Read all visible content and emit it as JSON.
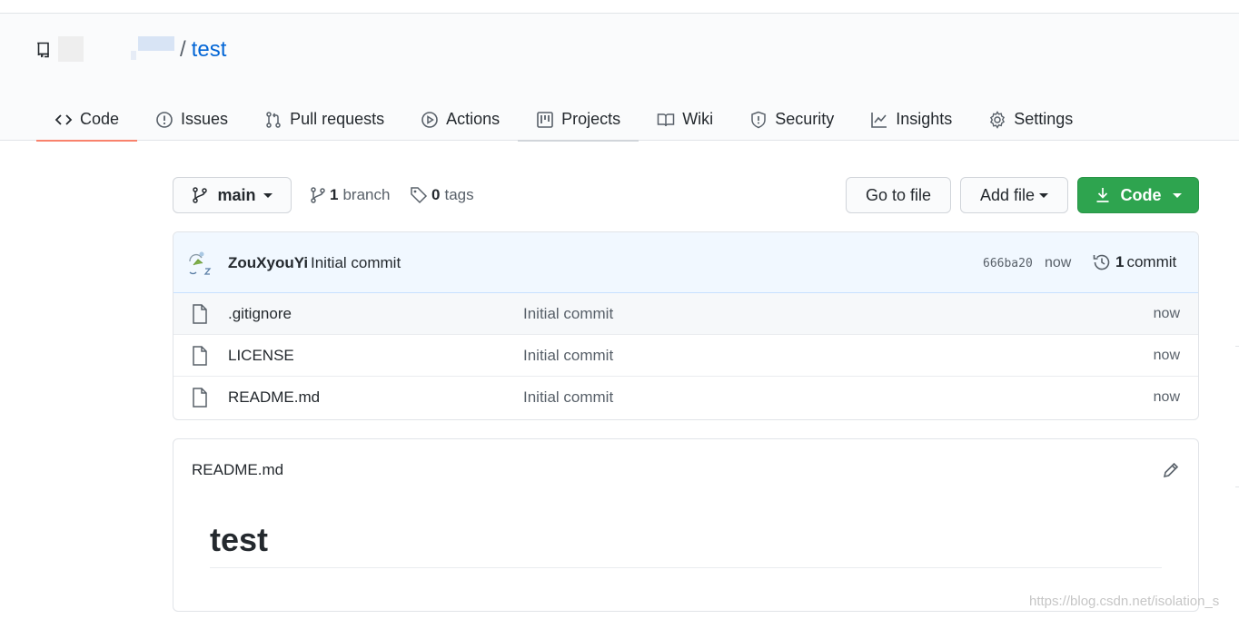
{
  "repo": {
    "name": "test",
    "separator": "/"
  },
  "tabs": [
    {
      "label": "Code",
      "icon": "code-icon"
    },
    {
      "label": "Issues",
      "icon": "issue-icon"
    },
    {
      "label": "Pull requests",
      "icon": "pull-request-icon"
    },
    {
      "label": "Actions",
      "icon": "play-icon"
    },
    {
      "label": "Projects",
      "icon": "project-icon"
    },
    {
      "label": "Wiki",
      "icon": "book-icon"
    },
    {
      "label": "Security",
      "icon": "shield-icon"
    },
    {
      "label": "Insights",
      "icon": "graph-icon"
    },
    {
      "label": "Settings",
      "icon": "gear-icon"
    }
  ],
  "toolbar": {
    "branch_selector": "main",
    "branch_count": "1",
    "branch_label": "branch",
    "tag_count": "0",
    "tag_label": "tags",
    "go_to_file": "Go to file",
    "add_file": "Add file",
    "code": "Code"
  },
  "latest_commit": {
    "author": "ZouXyouYi",
    "message": "Initial commit",
    "sha": "666ba20",
    "time": "now",
    "commit_count": "1",
    "commit_label": "commit"
  },
  "files": [
    {
      "name": ".gitignore",
      "message": "Initial commit",
      "age": "now"
    },
    {
      "name": "LICENSE",
      "message": "Initial commit",
      "age": "now"
    },
    {
      "name": "README.md",
      "message": "Initial commit",
      "age": "now"
    }
  ],
  "readme": {
    "filename": "README.md",
    "heading": "test"
  },
  "watermark": "https://blog.csdn.net/isolation_s",
  "colors": {
    "accent_link": "#0366d6",
    "selected_tab_underline": "#f9826c",
    "code_button": "#2ea44f",
    "commit_bar": "#f1f8ff"
  }
}
